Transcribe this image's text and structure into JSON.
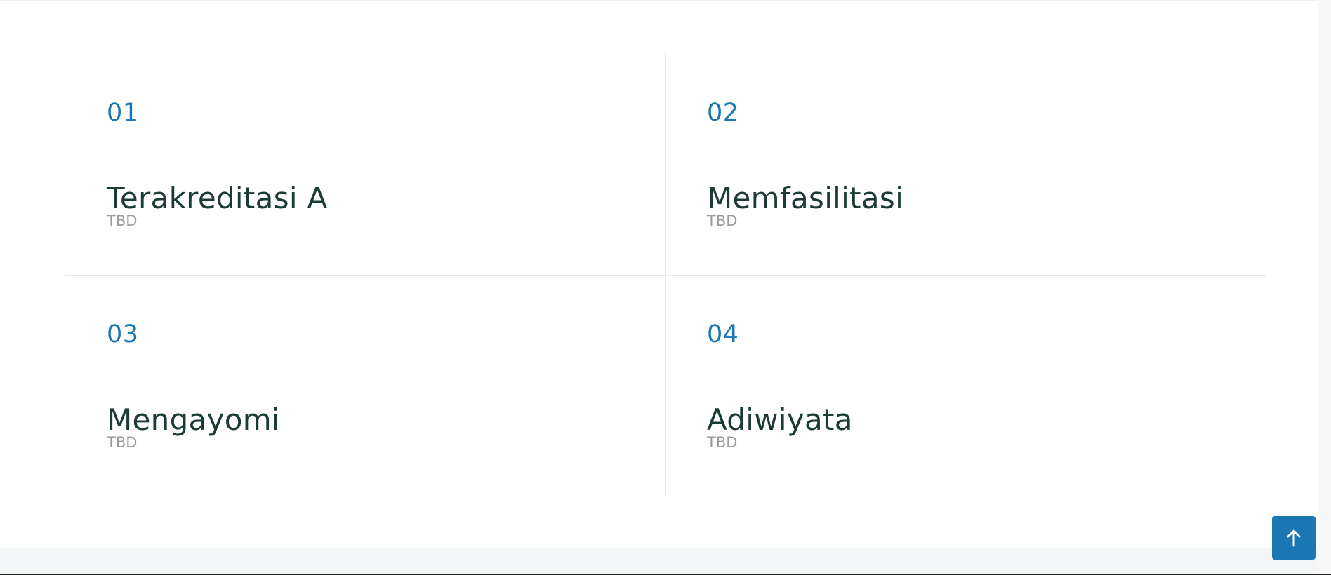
{
  "features": [
    {
      "number": "01",
      "title": "Terakreditasi A",
      "description": "TBD"
    },
    {
      "number": "02",
      "title": "Memfasilitasi",
      "description": "TBD"
    },
    {
      "number": "03",
      "title": "Mengayomi",
      "description": "TBD"
    },
    {
      "number": "04",
      "title": "Adiwiyata",
      "description": "TBD"
    }
  ],
  "back_to_top": {
    "icon": "arrow-up-icon"
  },
  "colors": {
    "accent": "#1a77b3",
    "title": "#1c3b36",
    "muted": "#9b9b9b",
    "divider": "#e3e9ec",
    "footer_band": "#f2f6f6"
  }
}
